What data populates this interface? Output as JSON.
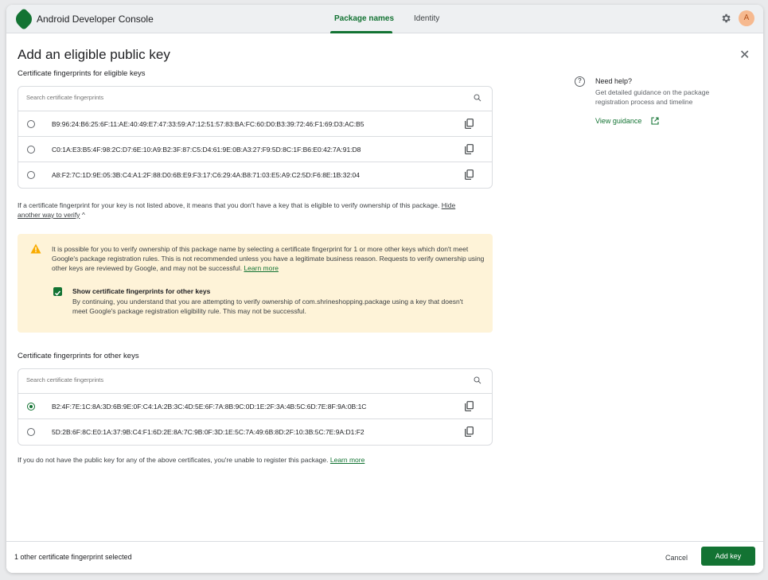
{
  "app": {
    "title": "Android Developer Console",
    "avatar_initial": "A"
  },
  "tabs": [
    {
      "label": "Package names",
      "active": true
    },
    {
      "label": "Identity",
      "active": false
    }
  ],
  "dialog": {
    "title": "Add an eligible public key",
    "eligible_section_label": "Certificate fingerprints for eligible keys",
    "search_placeholder": "Search certificate fingerprints",
    "eligible_fingerprints": [
      "B9:96:24:B6:25:6F:11:AE:40:49:E7:47:33:59:A7:12:51:57:83:BA:FC:60:D0:B3:39:72:46:F1:69:D3:AC:B5",
      "C0:1A:E3:B5:4F:98:2C:D7:6E:10:A9:B2:3F:87:C5:D4:61:9E:0B:A3:27:F9:5D:8C:1F:B6:E0:42:7A:91:D8",
      "A8:F2:7C:1D:9E:05:3B:C4:A1:2F:88:D0:6B:E9:F3:17:C6:29:4A:B8:71:03:E5:A9:C2:5D:F6:8E:1B:32:04"
    ],
    "not_listed_text": "If a certificate fingerprint for your key is not listed above, it means that you don't have a key that is eligible to verify ownership of this package.",
    "hide_link": "Hide another way to verify",
    "warning": {
      "text": "It is possible for you to verify ownership of this package name by selecting a certificate fingerprint for 1 or more other keys which don't meet Google's package registration  rules. This is not recommended unless you have a legitimate business reason. Requests to verify ownership using other keys are reviewed by Google, and may not be successful.",
      "learn_more": "Learn more",
      "checkbox_label": "Show certificate fingerprints for other keys",
      "checkbox_checked": true,
      "checkbox_desc": "By continuing, you understand that you are attempting to verify ownership of com.shrineshopping.package using a key that doesn't meet Google's package registration eligibility rule. This may not be successful."
    },
    "other_section_label": "Certificate fingerprints for other keys",
    "other_fingerprints": [
      {
        "value": "B2:4F:7E:1C:8A:3D:6B:9E:0F:C4:1A:2B:3C:4D:5E:6F:7A:8B:9C:0D:1E:2F:3A:4B:5C:6D:7E:8F:9A:0B:1C",
        "selected": true
      },
      {
        "value": "5D:2B:6F:8C:E0:1A:37:9B:C4:F1:6D:2E:8A:7C:9B:0F:3D:1E:5C:7A:49:6B:8D:2F:10:3B:5C:7E:9A:D1:F2",
        "selected": false
      }
    ],
    "no_key_text": "If you do not have the public key for any of the above certificates, you're unable to register this package.",
    "no_key_link": "Learn more"
  },
  "help": {
    "title": "Need help?",
    "description": "Get detailed guidance on the package registration process and timeline",
    "link": "View guidance"
  },
  "footer": {
    "status": "1 other certificate fingerprint selected",
    "cancel": "Cancel",
    "add_key": "Add key"
  },
  "colors": {
    "brand": "#137333",
    "warning_bg": "#fef3d8",
    "warning_icon": "#f9ab00"
  }
}
